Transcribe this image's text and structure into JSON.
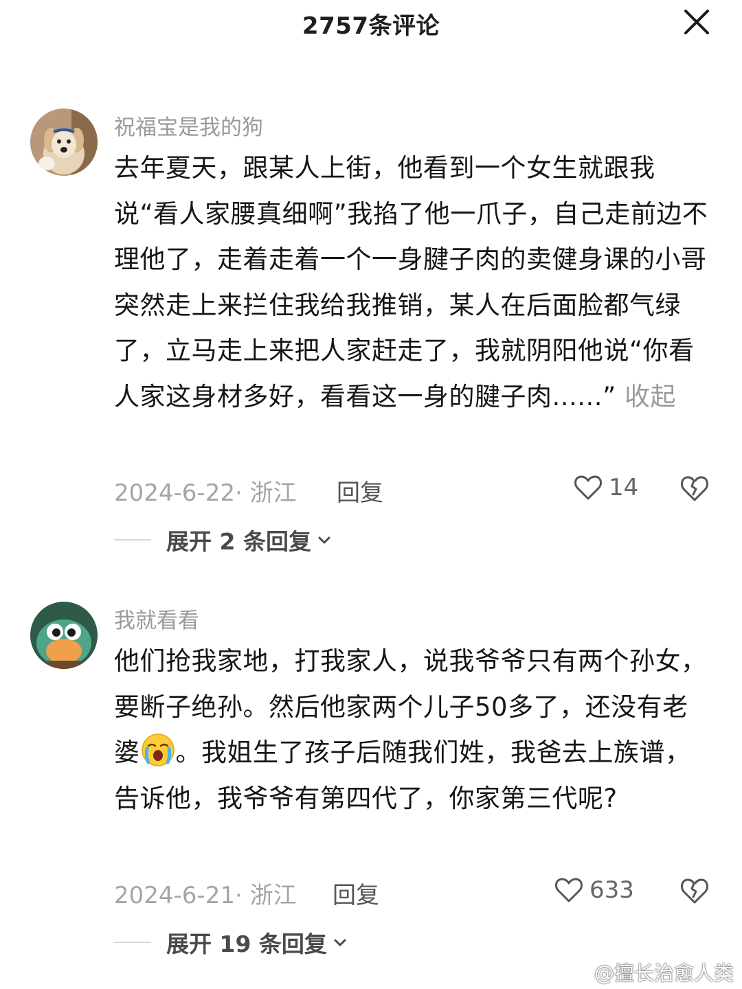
{
  "header": {
    "title": "2757条评论"
  },
  "comments": [
    {
      "username": "祝福宝是我的狗",
      "text": "去年夏天，跟某人上街，他看到一个女生就跟我说“看人家腰真细啊”我掐了他一爪子，自己走前边不理他了，走着走着一个一身腱子肉的卖健身课的小哥突然走上来拦住我给我推销，某人在后面脸都气绿了，立马走上来把人家赶走了，我就阴阳他说“你看人家这身材多好，看看这一身的腱子肉......”",
      "collapse_label": "收起",
      "date_location": "2024-6-22· 浙江",
      "reply_label": "回复",
      "likes": "14",
      "expand_label": "展开 2 条回复",
      "avatar_icon": "dog-avatar-icon"
    },
    {
      "username": "我就看看",
      "text_part1": "他们抢我家地，打我家人，说我爷爷只有两个孙女，要断子绝孙。然后他家两个儿子50多了，还没有老婆",
      "text_emoji": "crying-face-emoji",
      "text_part2": "。我姐生了孩子后随我们姓，我爸去上族谱，告诉他，我爷爷有第四代了，你家第三代呢?",
      "date_location": "2024-6-21· 浙江",
      "reply_label": "回复",
      "likes": "633",
      "expand_label": "展开 19 条回复",
      "avatar_icon": "cartoon-avatar-icon"
    }
  ],
  "watermark": {
    "text": "@擅长治愈人类"
  },
  "colors": {
    "muted": "#9a9a9a",
    "text": "#161616",
    "background": "#ffffff"
  }
}
